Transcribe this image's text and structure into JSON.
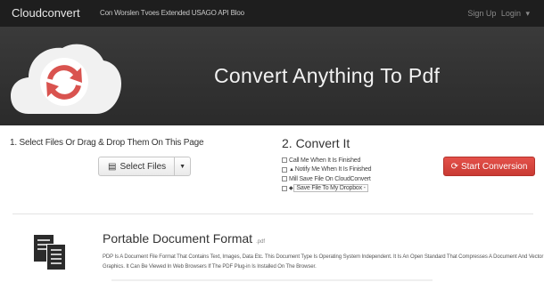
{
  "navbar": {
    "brand": "Cloudconvert",
    "links": "Con Worslen Tvoes Extended USAGO API Bloo",
    "sign_up": "Sign Up",
    "login": "Login",
    "login_caret": "▾"
  },
  "hero": {
    "title": "Convert Anything To Pdf"
  },
  "step1": {
    "title": "1. Select Files Or Drag & Drop Them On This Page",
    "select_files_label": "Select Files",
    "caret": "▼"
  },
  "step2": {
    "title": "2. Convert It",
    "options": [
      {
        "icon": "",
        "label": "Call Me When It Is Finished"
      },
      {
        "icon": "▲",
        "label": "Notify Me When It Is Finished"
      },
      {
        "icon": "",
        "label": "Mill Save File On CloudConvert"
      },
      {
        "icon": "◆",
        "label": "Save File To My Dropbox -"
      }
    ],
    "start_label": "Start Conversion"
  },
  "format": {
    "title": "Portable Document Format",
    "ext": ".pdf",
    "description": "PDP Is A Document File Format That Contains Text, Images, Data Etc. This Document Type Is Operating System Independent. It Is An Open Standard That Compresses A Document And Vector Graphics. It Can Be Viewed In Web Browsers If The PDF Plug-in Is Installed On The Browser."
  },
  "colors": {
    "navbar_bg": "#1e1e1e",
    "hero_bg": "#333333",
    "cloud_white": "#f1f1f1",
    "accent_red": "#d9534f"
  },
  "icons": {
    "logo": "cloud-refresh-icon",
    "select_files": "upload-files-icon",
    "start": "refresh-icon",
    "document": "document-stack-icon"
  }
}
